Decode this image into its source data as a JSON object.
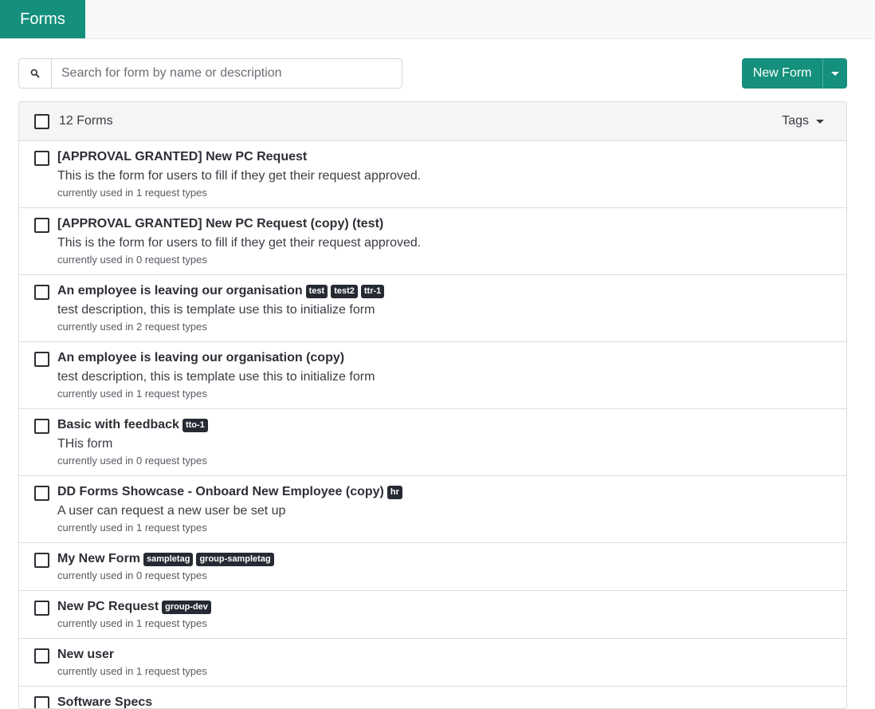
{
  "header": {
    "active_tab": "Forms"
  },
  "search": {
    "placeholder": "Search for form by name or description",
    "value": ""
  },
  "toolbar": {
    "new_form_label": "New Form"
  },
  "list": {
    "count_label": "12 Forms",
    "tags_label": "Tags",
    "rows": [
      {
        "title": "[APPROVAL GRANTED] New PC Request",
        "tags": [],
        "description": "This is the form for users to fill if they get their request approved.",
        "usage": "currently used in 1 request types"
      },
      {
        "title": "[APPROVAL GRANTED] New PC Request (copy) (test)",
        "tags": [],
        "description": "This is the form for users to fill if they get their request approved.",
        "usage": "currently used in 0 request types"
      },
      {
        "title": "An employee is leaving our organisation",
        "tags": [
          "test",
          "test2",
          "ttr-1"
        ],
        "description": "test description, this is template use this to initialize form",
        "usage": "currently used in 2 request types"
      },
      {
        "title": "An employee is leaving our organisation (copy)",
        "tags": [],
        "description": "test description, this is template use this to initialize form",
        "usage": "currently used in 1 request types"
      },
      {
        "title": "Basic with feedback",
        "tags": [
          "tto-1"
        ],
        "description": "THis form",
        "usage": "currently used in 0 request types"
      },
      {
        "title": "DD Forms Showcase - Onboard New Employee (copy)",
        "tags": [
          "hr"
        ],
        "description": "A user can request a new user be set up",
        "usage": "currently used in 1 request types"
      },
      {
        "title": "My New Form",
        "tags": [
          "sampletag",
          "group-sampletag"
        ],
        "description": "",
        "usage": "currently used in 0 request types"
      },
      {
        "title": "New PC Request",
        "tags": [
          "group-dev"
        ],
        "description": "",
        "usage": "currently used in 1 request types"
      },
      {
        "title": "New user",
        "tags": [],
        "description": "",
        "usage": "currently used in 1 request types"
      },
      {
        "title": "Software Specs",
        "tags": [],
        "description": "",
        "usage": ""
      }
    ]
  },
  "colors": {
    "accent": "#14907c",
    "tag_bg": "#262a33"
  }
}
